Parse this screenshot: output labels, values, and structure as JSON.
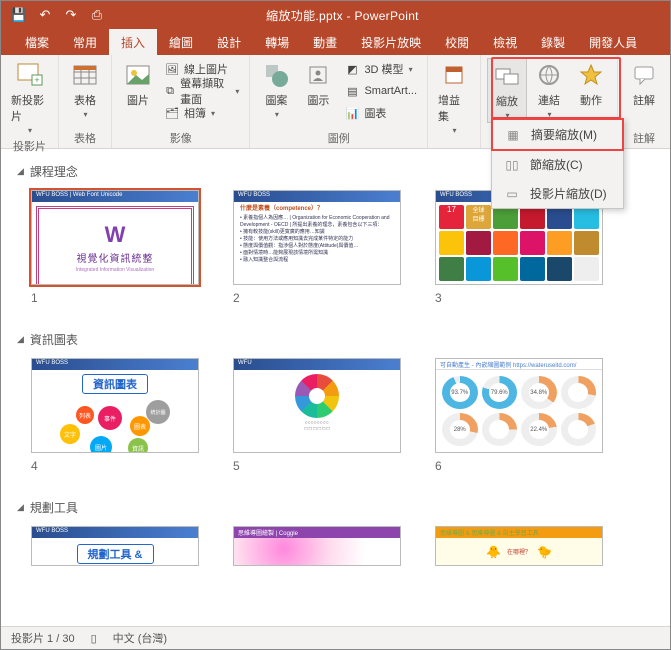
{
  "qat": {
    "save": "💾",
    "undo": "↶",
    "redo": "↷",
    "start": "⎙"
  },
  "title": "縮放功能.pptx - PowerPoint",
  "tabs": [
    "檔案",
    "常用",
    "插入",
    "繪圖",
    "設計",
    "轉場",
    "動畫",
    "投影片放映",
    "校閱",
    "檢視",
    "錄製",
    "開發人員"
  ],
  "active_tab": "插入",
  "ribbon": {
    "g1": {
      "btn": "新投影片",
      "label": "投影片"
    },
    "g2": {
      "btn": "表格",
      "label": "表格"
    },
    "g3": {
      "btn": "圖片",
      "sm1": "線上圖片",
      "sm2": "螢幕擷取畫面",
      "sm3": "相簿",
      "label": "影像"
    },
    "g4": {
      "b1": "圖案",
      "b2": "圖示",
      "b3": "3D 模型",
      "b4": "SmartArt...",
      "b5": "圖表",
      "label": "圖例"
    },
    "g5": {
      "btn": "增益集"
    },
    "g6": {
      "b1": "縮放",
      "b2": "連結",
      "b3": "動作"
    },
    "g7": {
      "btn": "註解",
      "label": "註解"
    }
  },
  "dropdown": {
    "i1": "摘要縮放(M)",
    "i2": "節縮放(C)",
    "i3": "投影片縮放(D)"
  },
  "sections": {
    "s1": "課程理念",
    "s2": "資訊圖表",
    "s3": "規劃工具"
  },
  "slides": {
    "n1": "1",
    "n2": "2",
    "n3": "3",
    "n4": "4",
    "n5": "5",
    "n6": "6",
    "s1_title": "視覺化資訊統整",
    "s1_sub": "Integrated Information Visualization",
    "s2_tt": "什麼是素養（competence）？",
    "s4_title": "資訊圖表",
    "s6_v1": "93.7%",
    "s6_v2": "79.6%",
    "s6_v3": "34.8%",
    "s6_v4": "28%",
    "s6_v5": "22.4%",
    "s7_title": "規劃工具 &"
  },
  "status": {
    "slide": "投影片 1 / 30",
    "lang": "中文 (台灣)"
  }
}
